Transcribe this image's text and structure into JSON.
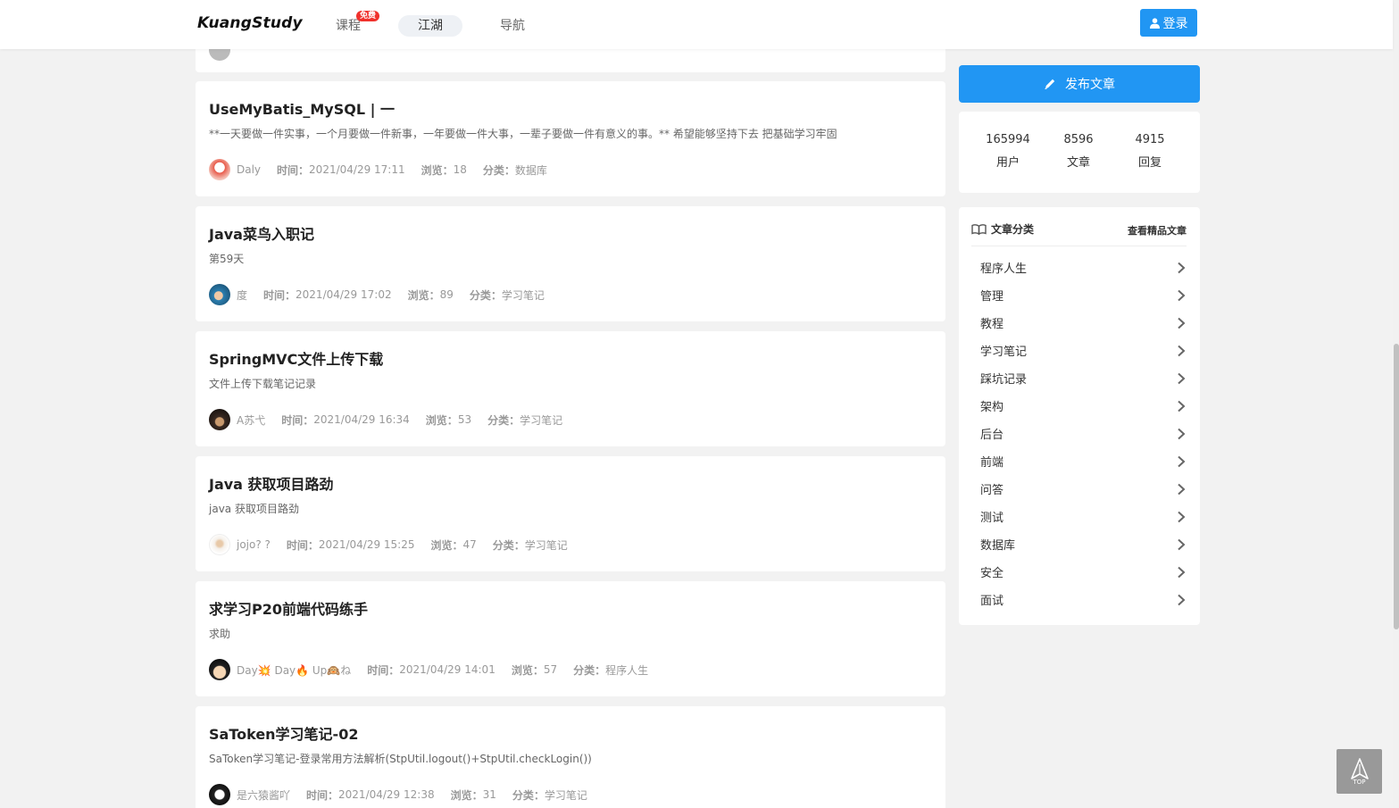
{
  "header": {
    "logo": "KuangStudy",
    "nav": {
      "course": "课程",
      "free_badge": "免费",
      "jianghu": "江湖",
      "guide": "导航"
    },
    "login_label": "登录"
  },
  "labels": {
    "time": "时间：",
    "views": "浏览：",
    "category": "分类："
  },
  "articles": [
    {
      "title": "UseMyBatis_MySQL | 一",
      "desc": "**一天要做一件实事，一个月要做一件新事，一年要做一件大事，一辈子要做一件有意义的事。** 希望能够坚持下去 把基础学习牢固",
      "author": "Daly",
      "time": "2021/04/29 17:11",
      "views": "18",
      "category": "数据库"
    },
    {
      "title": "Java菜鸟入职记",
      "desc": "第59天",
      "author": "度",
      "time": "2021/04/29 17:02",
      "views": "89",
      "category": "学习笔记"
    },
    {
      "title": "SpringMVC文件上传下载",
      "desc": "文件上传下载笔记记录",
      "author": "A苏弋",
      "time": "2021/04/29 16:34",
      "views": "53",
      "category": "学习笔记"
    },
    {
      "title": "Java 获取项目路劲",
      "desc": "java 获取项目路劲",
      "author": "jojo? ?",
      "time": "2021/04/29 15:25",
      "views": "47",
      "category": "学习笔记"
    },
    {
      "title": "求学习P20前端代码练手",
      "desc": "求助",
      "author": "Day💥 Day🔥 Up🙉ね",
      "time": "2021/04/29 14:01",
      "views": "57",
      "category": "程序人生"
    },
    {
      "title": "SaToken学习笔记-02",
      "desc": "SaToken学习笔记-登录常用方法解析(StpUtil.logout()+StpUtil.checkLogin())",
      "author": "是六猿酱吖",
      "time": "2021/04/29 12:38",
      "views": "31",
      "category": "学习笔记"
    }
  ],
  "sidebar": {
    "publish_label": "发布文章",
    "stats": {
      "users": {
        "value": "165994",
        "label": "用户"
      },
      "articles": {
        "value": "8596",
        "label": "文章"
      },
      "replies": {
        "value": "4915",
        "label": "回复"
      }
    },
    "categories_title": "文章分类",
    "categories_more": "查看精品文章",
    "categories": [
      "程序人生",
      "管理",
      "教程",
      "学习笔记",
      "踩坑记录",
      "架构",
      "后台",
      "前端",
      "问答",
      "测试",
      "数据库",
      "安全",
      "面试"
    ]
  },
  "top_button_label": "TOP",
  "colors": {
    "accent": "#2196f3",
    "badge": "#f0312c",
    "background": "#f2f2f2"
  }
}
